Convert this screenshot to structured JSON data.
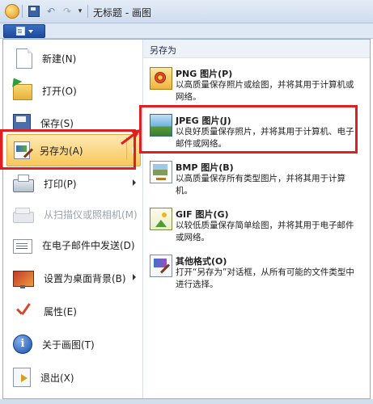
{
  "window": {
    "title": "无标题 - 画图",
    "quick_access": [
      "save-icon",
      "undo-icon",
      "redo-icon",
      "customize-arrow-icon"
    ]
  },
  "left_menu": {
    "items": [
      {
        "label": "新建(N)",
        "icon": "new-document-icon"
      },
      {
        "label": "打开(O)",
        "icon": "open-folder-icon"
      },
      {
        "label": "保存(S)",
        "icon": "save-disk-icon"
      },
      {
        "label": "另存为(A)",
        "icon": "save-as-icon",
        "selected": true,
        "submenu": true
      },
      {
        "label": "打印(P)",
        "icon": "printer-icon",
        "submenu": true
      },
      {
        "label": "从扫描仪或照相机(M)",
        "icon": "scanner-icon",
        "disabled": true
      },
      {
        "label": "在电子邮件中发送(D)",
        "icon": "email-icon"
      },
      {
        "label": "设置为桌面背景(B)",
        "icon": "desktop-background-icon",
        "submenu": true
      },
      {
        "label": "属性(E)",
        "icon": "checkmark-icon"
      },
      {
        "label": "关于画图(T)",
        "icon": "info-icon"
      },
      {
        "label": "退出(X)",
        "icon": "exit-icon"
      }
    ]
  },
  "save_as_panel": {
    "title": "另存为",
    "items": [
      {
        "name": "PNG 图片(P)",
        "desc": "以高质量保存照片或绘图，并将其用于计算机或网络。",
        "icon": "png-image-icon"
      },
      {
        "name": "JPEG 图片(J)",
        "desc": "以良好质量保存照片，并将其用于计算机、电子邮件或网络。",
        "icon": "jpeg-image-icon",
        "highlighted": true
      },
      {
        "name": "BMP 图片(B)",
        "desc": "以高质量保存所有类型图片，并将其用于计算机。",
        "icon": "bmp-image-icon"
      },
      {
        "name": "GIF 图片(G)",
        "desc": "以较低质量保存简单绘图，并将其用于电子邮件或网络。",
        "icon": "gif-image-icon"
      },
      {
        "name": "其他格式(O)",
        "desc": "打开“另存为”对话框，从所有可能的文件类型中进行选择。",
        "icon": "other-formats-icon"
      }
    ]
  },
  "colors": {
    "highlight": "#e02020",
    "selection": "#f8c75a"
  }
}
